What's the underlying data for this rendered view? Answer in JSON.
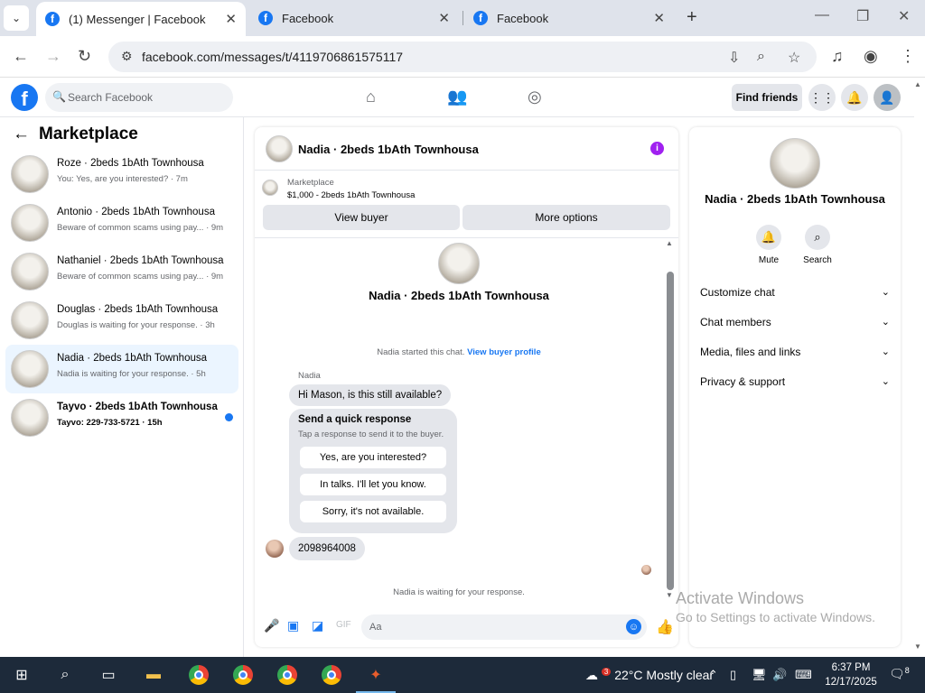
{
  "browser": {
    "tabs": [
      {
        "title": "(1) Messenger | Facebook"
      },
      {
        "title": "Facebook"
      },
      {
        "title": "Facebook"
      }
    ],
    "url": "facebook.com/messages/t/4119706861575117"
  },
  "fb_header": {
    "search_placeholder": "Search Facebook",
    "find_friends": "Find friends"
  },
  "left": {
    "title": "Marketplace",
    "chats": [
      {
        "name": "Roze · 2beds 1bAth Townhousa",
        "preview": "You: Yes, are you interested? · 7m"
      },
      {
        "name": "Antonio · 2beds 1bAth Townhousa",
        "preview": "Beware of common scams using pay... · 9m"
      },
      {
        "name": "Nathaniel · 2beds 1bAth Townhousa",
        "preview": "Beware of common scams using pay... · 9m"
      },
      {
        "name": "Douglas · 2beds 1bAth Townhousa",
        "preview": "Douglas is waiting for your response. · 3h"
      },
      {
        "name": "Nadia · 2beds 1bAth Townhousa",
        "preview": "Nadia is waiting for your response. · 5h"
      },
      {
        "name": "Tayvo · 2beds 1bAth Townhousa",
        "preview": "Tayvo: 229-733-5721 · 15h"
      }
    ]
  },
  "conversation": {
    "title": "Nadia · 2beds 1bAth Townhousa",
    "marketplace_label": "Marketplace",
    "listing": "$1,000 - 2beds 1bAth Townhousa",
    "view_buyer": "View buyer",
    "more_options": "More options",
    "intro_name": "Nadia · 2beds 1bAth Townhousa",
    "started_text": "Nadia started this chat.",
    "view_profile_link": "View buyer profile",
    "sender": "Nadia",
    "message1": "Hi Mason, is this still available?",
    "quick_title": "Send a quick response",
    "quick_sub": "Tap a response to send it to the buyer.",
    "quick_responses": [
      "Yes, are you interested?",
      "In talks. I'll let you know.",
      "Sorry, it's not available."
    ],
    "message2": "2098964008",
    "waiting": "Nadia is waiting for your response.",
    "composer_placeholder": "Aa"
  },
  "right": {
    "name": "Nadia · 2beds 1bAth Townhousa",
    "mute": "Mute",
    "search": "Search",
    "sections": [
      "Customize chat",
      "Chat members",
      "Media, files and links",
      "Privacy & support"
    ]
  },
  "watermark": {
    "line1": "Activate Windows",
    "line2": "Go to Settings to activate Windows."
  },
  "taskbar": {
    "weather_temp": "22°C",
    "weather_text": "Mostly clear",
    "time": "6:37 PM",
    "date": "12/17/2025",
    "notif_count": "8",
    "chrome_badge": "3"
  }
}
